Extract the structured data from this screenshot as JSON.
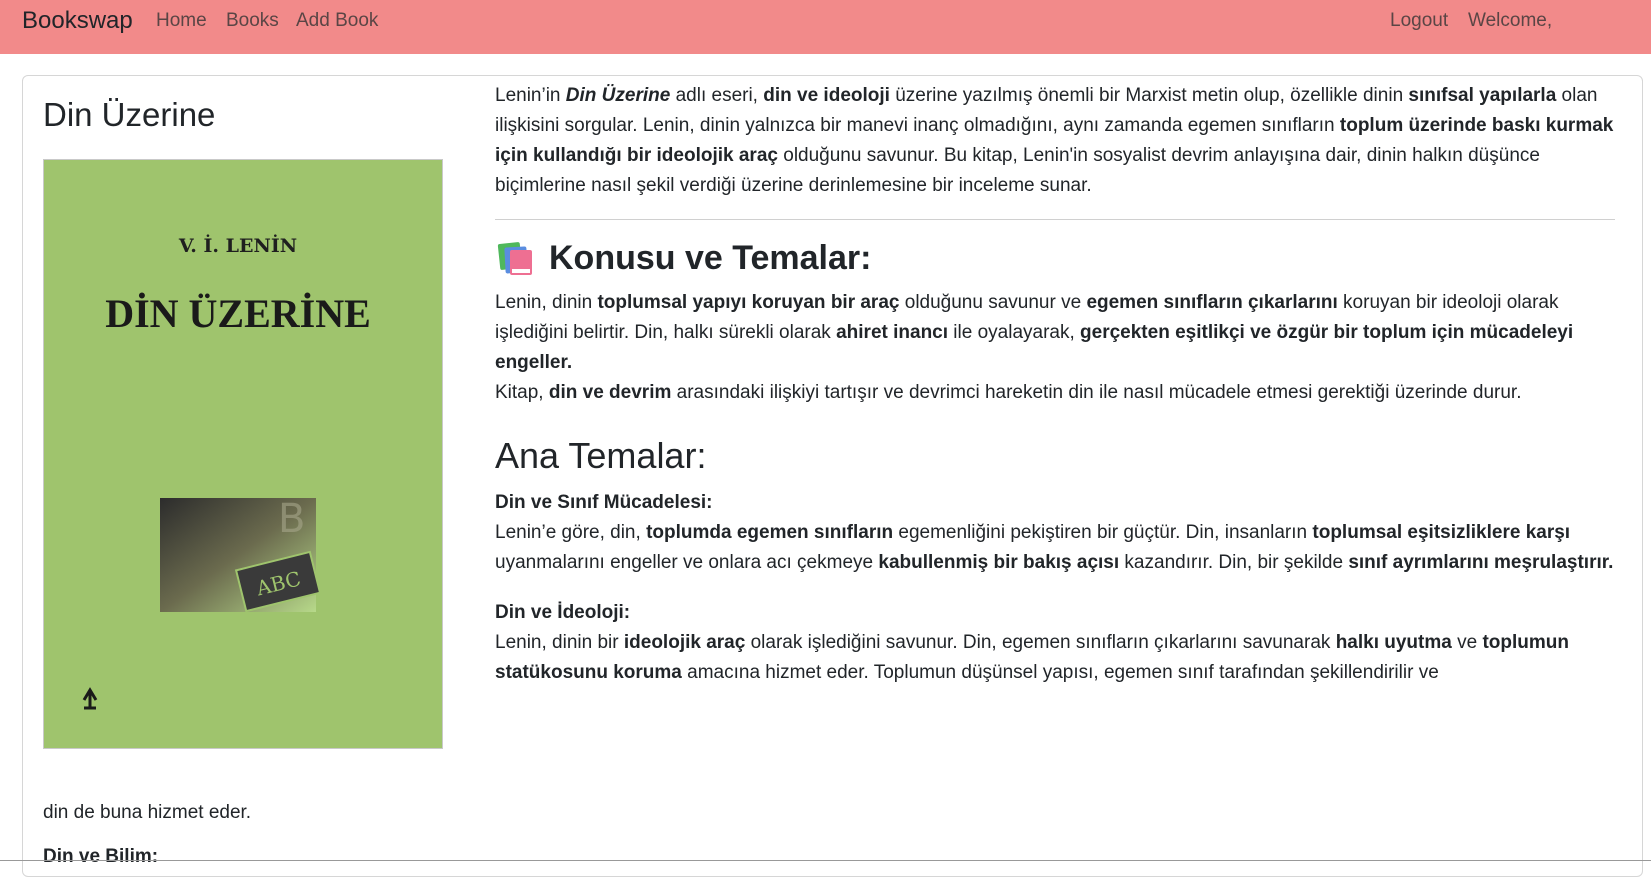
{
  "nav": {
    "brand": "Bookswap",
    "home": "Home",
    "books": "Books",
    "add_book": "Add Book",
    "logout": "Logout",
    "welcome": "Welcome,"
  },
  "colors": {
    "navbar": "#f28a8a",
    "cover_green": "#9fc46d"
  },
  "book": {
    "title": "Din Üzerine",
    "cover": {
      "author": "V. İ. LENİN",
      "title": "DİN ÜZERİNE",
      "letters": "ABC"
    }
  },
  "intro": [
    {
      "t": "Lenin’in "
    },
    {
      "t": "Din Üzerine",
      "b": true,
      "i": true
    },
    {
      "t": " adlı eseri, "
    },
    {
      "t": "din ve ideoloji",
      "b": true
    },
    {
      "t": " üzerine yazılmış önemli bir Marxist metin olup, özellikle dinin "
    },
    {
      "t": "sınıfsal yapılarla",
      "b": true
    },
    {
      "t": " olan ilişkisini sorgular. Lenin, dinin yalnızca bir manevi inanç olmadığını, aynı zamanda egemen sınıfların "
    },
    {
      "t": "toplum üzerinde baskı kurmak için kullandığı bir ideolojik araç",
      "b": true
    },
    {
      "t": " olduğunu savunur. Bu kitap, Lenin'in sosyalist devrim anlayışına dair, dinin halkın düşünce biçimlerine nasıl şekil verdiği üzerine derinlemesine bir inceleme sunar."
    }
  ],
  "konu": {
    "heading": "Konusu ve Temalar:",
    "p1": [
      {
        "t": "Lenin, dinin "
      },
      {
        "t": "toplumsal yapıyı koruyan bir araç",
        "b": true
      },
      {
        "t": " olduğunu savunur ve "
      },
      {
        "t": "egemen sınıfların çıkarlarını",
        "b": true
      },
      {
        "t": " koruyan bir ideoloji olarak işlediğini belirtir. Din, halkı sürekli olarak "
      },
      {
        "t": "ahiret inancı",
        "b": true
      },
      {
        "t": " ile oyalayarak, "
      },
      {
        "t": "gerçekten eşitlikçi ve özgür bir toplum için mücadeleyi engeller.",
        "b": true
      }
    ],
    "p2": [
      {
        "t": "Kitap, "
      },
      {
        "t": "din ve devrim",
        "b": true
      },
      {
        "t": " arasındaki ilişkiyi tartışır ve devrimci hareketin din ile nasıl mücadele etmesi gerektiği üzerinde durur."
      }
    ]
  },
  "ana": {
    "heading": "Ana Temalar:",
    "s1_title": "Din ve Sınıf Mücadelesi:",
    "s1": [
      {
        "t": "Lenin’e göre, din, "
      },
      {
        "t": "toplumda egemen sınıfların",
        "b": true
      },
      {
        "t": " egemenliğini pekiştiren bir güçtür. Din, insanların "
      },
      {
        "t": "toplumsal eşitsizliklere karşı",
        "b": true
      },
      {
        "t": " uyanmalarını engeller ve onlara acı çekmeye "
      },
      {
        "t": "kabullenmiş bir bakış açısı",
        "b": true
      },
      {
        "t": " kazandırır. Din, bir şekilde "
      },
      {
        "t": "sınıf ayrımlarını meşrulaştırır.",
        "b": true
      }
    ],
    "s2_title": "Din ve İdeoloji:",
    "s2": [
      {
        "t": "Lenin, dinin bir "
      },
      {
        "t": "ideolojik araç",
        "b": true
      },
      {
        "t": " olarak işlediğini savunur. Din, egemen sınıfların çıkarlarını savunarak "
      },
      {
        "t": "halkı uyutma",
        "b": true
      },
      {
        "t": " ve "
      },
      {
        "t": "toplumun statükosunu koruma",
        "b": true
      },
      {
        "t": " amacına hizmet eder. Toplumun düşünsel yapısı, egemen sınıf tarafından şekillendirilir ve"
      }
    ],
    "s2_tail": "din de buna hizmet eder.",
    "s3_title": "Din ve Bilim:"
  }
}
